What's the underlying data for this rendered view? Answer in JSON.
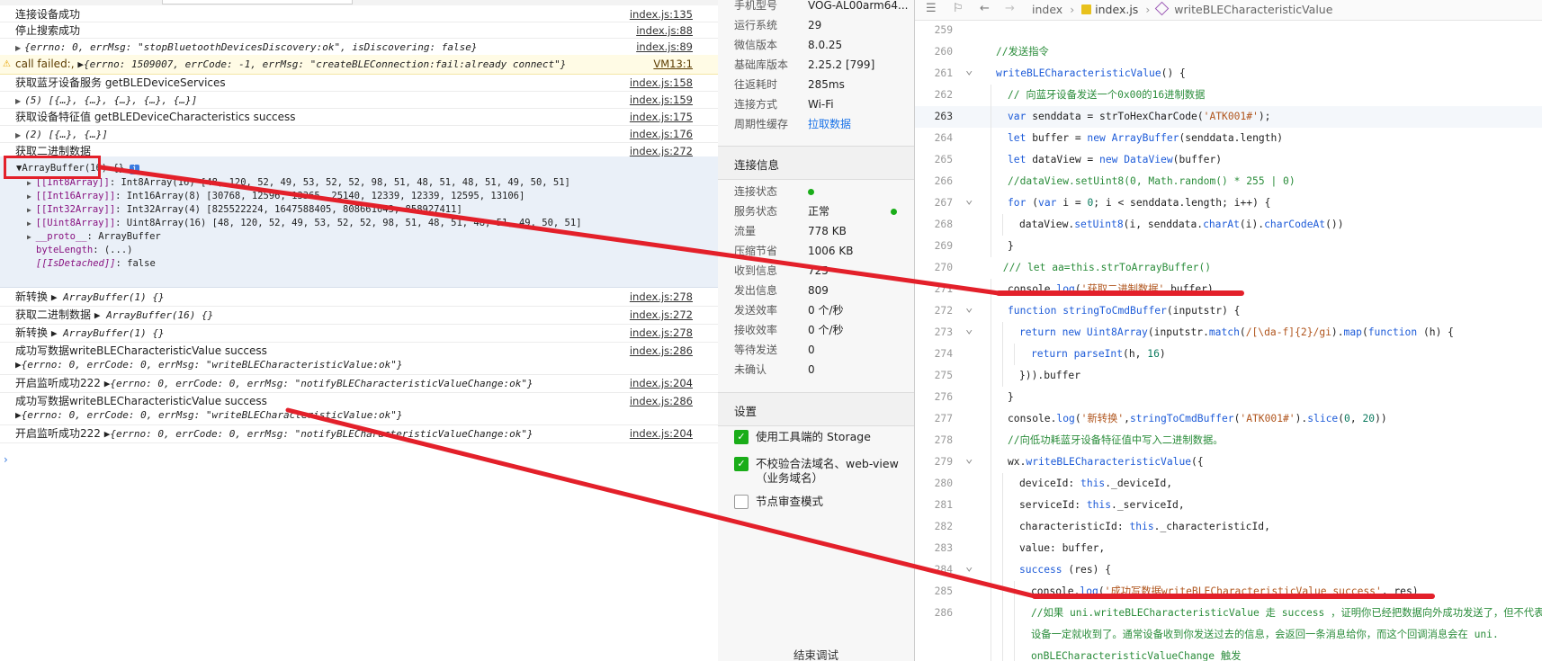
{
  "console": {
    "rows": [
      {
        "msg": "连接设备成功",
        "src": "index.js:135"
      },
      {
        "msg": "停止搜索成功",
        "src": "index.js:88"
      },
      {
        "prefix": "▶",
        "obj": "{errno: 0, errMsg: \"stopBluetoothDevicesDiscovery:ok\", isDiscovering: false}",
        "src": "index.js:89"
      },
      {
        "warn": true,
        "msg": "call failed:,",
        "obj": "▶{errno: 1509007, errCode: -1, errMsg: \"createBLEConnection:fail:already connect\"}",
        "src": "VM13:1"
      },
      {
        "msg": "获取蓝牙设备服务 getBLEDeviceServices",
        "src": "index.js:158"
      },
      {
        "prefix": "▶",
        "obj": "(5) [{…}, {…}, {…}, {…}, {…}]",
        "src": "index.js:159"
      },
      {
        "msg": "获取设备特征值 getBLEDeviceCharacteristics success",
        "src": "index.js:175"
      },
      {
        "prefix": "▶",
        "obj": "(2) [{…}, {…}]",
        "src": "index.js:176"
      },
      {
        "msg": "获取二进制数据",
        "src": "index.js:272"
      }
    ],
    "expanded": {
      "head": "▼ArrayBuffer(16) {}",
      "info_badge": "i",
      "lines": [
        {
          "prop": "[[Int8Array]]",
          "rest": ": Int8Array(16) [48, 120, 52, 49, 53, 52, 52, 98, 51, 48, 51, 48, 51, 49, 50, 51]"
        },
        {
          "prop": "[[Int16Array]]",
          "rest": ": Int16Array(8) [30768, 12596, 13365, 25140, 12339, 12339, 12595, 13106]"
        },
        {
          "prop": "[[Int32Array]]",
          "rest": ": Int32Array(4) [825522224, 1647588405, 808661043, 858927411]"
        },
        {
          "prop": "[[Uint8Array]]",
          "rest": ": Uint8Array(16) [48, 120, 52, 49, 53, 52, 52, 98, 51, 48, 51, 48, 51, 49, 50, 51]"
        },
        {
          "prop": "__proto__",
          "rest": ": ArrayBuffer"
        },
        {
          "prop": "byteLength",
          "rest": ": (...)"
        },
        {
          "prop": "[[IsDetached]]",
          "rest": ": false"
        }
      ]
    },
    "rows2": [
      {
        "msg": "新转换",
        "obj": "▶ ArrayBuffer(1) {}",
        "src": "index.js:278"
      },
      {
        "msg": "获取二进制数据",
        "obj": "▶ ArrayBuffer(16) {}",
        "src": "index.js:272"
      },
      {
        "msg": "新转换",
        "obj": "▶ ArrayBuffer(1) {}",
        "src": "index.js:278"
      },
      {
        "msg": "成功写数据writeBLECharacteristicValue success",
        "sub": "▶{errno: 0, errCode: 0, errMsg: \"writeBLECharacteristicValue:ok\"}",
        "src": "index.js:286"
      },
      {
        "msg": "开启监听成功222",
        "obj": "▶{errno: 0, errCode: 0, errMsg: \"notifyBLECharacteristicValueChange:ok\"}",
        "src": "index.js:204"
      },
      {
        "msg": "成功写数据writeBLECharacteristicValue success",
        "sub": "▶{errno: 0, errCode: 0, errMsg: \"writeBLECharacteristicValue:ok\"}",
        "src": "index.js:286"
      },
      {
        "msg": "开启监听成功222",
        "obj": "▶{errno: 0, errCode: 0, errMsg: \"notifyBLECharacteristicValueChange:ok\"}",
        "src": "index.js:204"
      }
    ],
    "prompt": "›"
  },
  "device": {
    "info": [
      {
        "label": "手机型号",
        "value": "VOG-AL00arm64..."
      },
      {
        "label": "运行系统",
        "value": "29"
      },
      {
        "label": "微信版本",
        "value": "8.0.25"
      },
      {
        "label": "基础库版本",
        "value": "2.25.2 [799]"
      },
      {
        "label": "往返耗时",
        "value": "285ms"
      },
      {
        "label": "连接方式",
        "value": "Wi-Fi"
      },
      {
        "label": "周期性缓存",
        "value": "拉取数据",
        "link": true
      }
    ],
    "conn_title": "连接信息",
    "conn": [
      {
        "label": "连接状态",
        "dot": true
      },
      {
        "label": "服务状态",
        "value": "正常",
        "dot_right": true
      },
      {
        "label": "流量",
        "value": "778 KB"
      },
      {
        "label": "压缩节省",
        "value": "1006 KB"
      },
      {
        "label": "收到信息",
        "value": "725"
      },
      {
        "label": "发出信息",
        "value": "809"
      },
      {
        "label": "发送效率",
        "value": "0 个/秒"
      },
      {
        "label": "接收效率",
        "value": "0 个/秒"
      },
      {
        "label": "等待发送",
        "value": "0"
      },
      {
        "label": "未确认",
        "value": "0"
      }
    ],
    "settings_title": "设置",
    "settings": [
      {
        "label": "使用工具端的 Storage",
        "checked": true
      },
      {
        "label": "不校验合法域名、web-view（业务域名）",
        "checked": true
      },
      {
        "label": "节点审查模式",
        "checked": false
      }
    ],
    "bottom_button": "结束调试"
  },
  "editor": {
    "breadcrumb": [
      "index",
      "index.js",
      "writeBLECharacteristicValue"
    ],
    "lines": [
      {
        "n": "259",
        "html": ""
      },
      {
        "n": "260",
        "html": "<span class='c-com'>//发送指令</span>",
        "indent": 0
      },
      {
        "n": "261",
        "fold": true,
        "html": "<span class='c-fn'>writeBLECharacteristicValue</span>() {",
        "indent": 0
      },
      {
        "n": "262",
        "html": "<span class='c-com'>// 向蓝牙设备发送一个0x00的16进制数据</span>",
        "indent": 1
      },
      {
        "n": "263",
        "cur": true,
        "html": "<span class='c-kw'>var</span> senddata = strToHexCharCode(<span class='c-str'>'ATK001#'</span>);",
        "indent": 1
      },
      {
        "n": "264",
        "html": "<span class='c-kw'>let</span> buffer = <span class='c-kw'>new</span> <span class='c-fn'>ArrayBuffer</span>(senddata.length)",
        "indent": 1
      },
      {
        "n": "265",
        "html": "<span class='c-kw'>let</span> dataView = <span class='c-kw'>new</span> <span class='c-fn'>DataView</span>(buffer)",
        "indent": 1
      },
      {
        "n": "266",
        "html": "<span class='c-com'>//dataView.setUint8(0, Math.random() * 255 | 0)</span>",
        "indent": 1
      },
      {
        "n": "267",
        "fold": true,
        "html": "<span class='c-kw'>for</span> (<span class='c-kw'>var</span> i = <span class='c-num'>0</span>; i &lt; senddata.length; i++) {",
        "indent": 1
      },
      {
        "n": "268",
        "html": "dataView.<span class='c-fn'>setUint8</span>(i, senddata.<span class='c-fn'>charAt</span>(i).<span class='c-fn'>charCodeAt</span>())",
        "indent": 2
      },
      {
        "n": "269",
        "html": "}",
        "indent": 1
      },
      {
        "n": "270",
        "html": "<span class='c-com'>/// let aa=this.strToArrayBuffer()</span>",
        "indent": 0.6
      },
      {
        "n": "271",
        "html": "console.<span class='c-fn'>log</span>(<span class='c-str'>'获取二进制数据'</span>,buffer)",
        "indent": 1
      },
      {
        "n": "272",
        "fold": true,
        "html": "<span class='c-kw'>function</span> <span class='c-fn'>stringToCmdBuffer</span>(inputstr) {",
        "indent": 1
      },
      {
        "n": "273",
        "fold": true,
        "html": "<span class='c-kw'>return</span> <span class='c-kw'>new</span> <span class='c-fn'>Uint8Array</span>(inputstr.<span class='c-fn'>match</span>(<span class='c-reg'>/[\\da-f]{2}/gi</span>).<span class='c-fn'>map</span>(<span class='c-kw'>function</span> (h) {",
        "indent": 2
      },
      {
        "n": "274",
        "html": "<span class='c-kw'>return</span> <span class='c-fn'>parseInt</span>(h, <span class='c-num'>16</span>)",
        "indent": 3
      },
      {
        "n": "275",
        "html": "})).buffer",
        "indent": 2
      },
      {
        "n": "276",
        "html": "}",
        "indent": 1
      },
      {
        "n": "277",
        "html": "console.<span class='c-fn'>log</span>(<span class='c-str'>'新转换'</span>,<span class='c-fn'>stringToCmdBuffer</span>(<span class='c-str'>'ATK001#'</span>).<span class='c-fn'>slice</span>(<span class='c-num'>0</span>, <span class='c-num'>20</span>))",
        "indent": 1
      },
      {
        "n": "278",
        "html": "<span class='c-com'>//向低功耗蓝牙设备特征值中写入二进制数据。</span>",
        "indent": 1
      },
      {
        "n": "279",
        "fold": true,
        "html": "wx.<span class='c-fn'>writeBLECharacteristicValue</span>({",
        "indent": 1
      },
      {
        "n": "280",
        "html": "deviceId: <span class='c-kw'>this</span>._deviceId,",
        "indent": 2
      },
      {
        "n": "281",
        "html": "serviceId: <span class='c-kw'>this</span>._serviceId,",
        "indent": 2
      },
      {
        "n": "282",
        "html": "characteristicId: <span class='c-kw'>this</span>._characteristicId,",
        "indent": 2
      },
      {
        "n": "283",
        "html": "value: buffer,",
        "indent": 2
      },
      {
        "n": "284",
        "fold": true,
        "html": "<span class='c-fn'>success</span> (res) {",
        "indent": 2
      },
      {
        "n": "285",
        "html": "console.<span class='c-fn'>log</span>(<span class='c-str'>'成功写数据writeBLECharacteristicValue success'</span>, res)",
        "indent": 3
      },
      {
        "n": "286",
        "html": "<span class='c-com'>//如果 uni.writeBLECharacteristicValue 走 success ，证明你已经把数据向外成功发送了，但不代表</span>",
        "indent": 3
      },
      {
        "n": "",
        "html": "<span class='c-com'>设备一定就收到了。通常设备收到你发送过去的信息，会返回一条消息给你，而这个回调消息会在 uni.</span>",
        "indent": 3
      },
      {
        "n": "",
        "html": "<span class='c-com'>onBLECharacteristicValueChange 触发</span>",
        "indent": 3
      }
    ]
  },
  "colors": {
    "annotation_red": "#e3202a",
    "green_ok": "#1aad19"
  }
}
